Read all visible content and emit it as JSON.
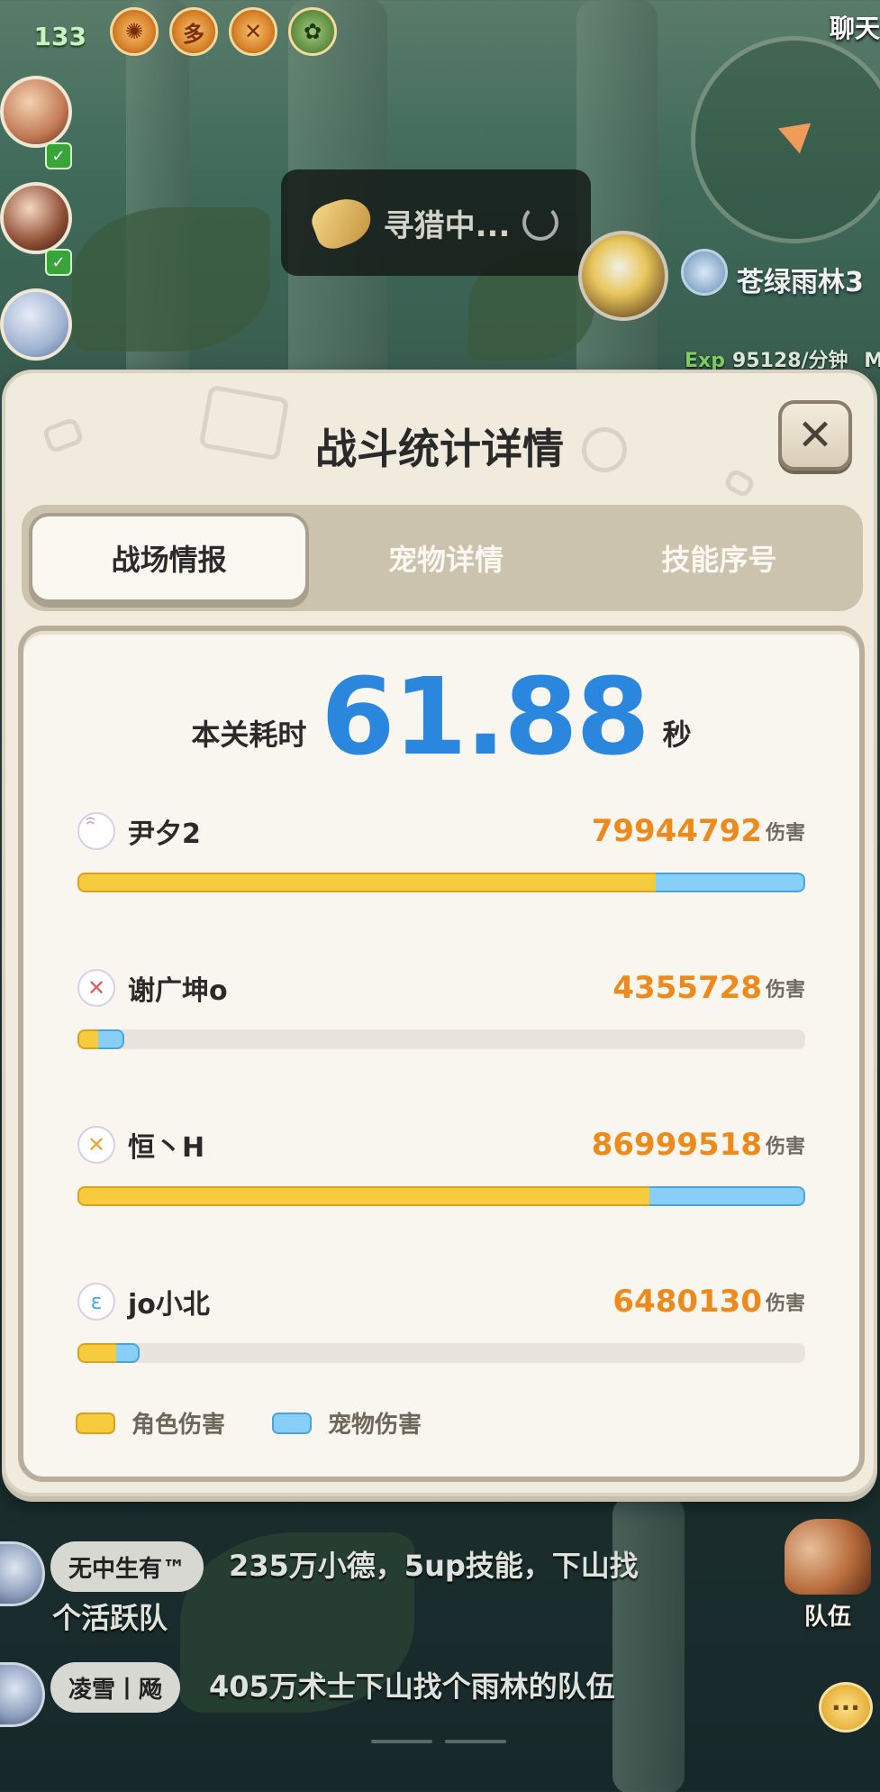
{
  "hud": {
    "level": "133",
    "chat_label": "聊天",
    "hunting_text": "寻猎中...",
    "zone_name": "苍绿雨林3",
    "exp_key": "Exp",
    "exp_value": "95128/分钟",
    "exp_suffix": "Ma"
  },
  "buffs": [
    "✺",
    "多",
    "✕",
    "✿"
  ],
  "modal": {
    "title": "战斗统计详情",
    "close_label": "✕",
    "tabs": [
      {
        "label": "战场情报",
        "active": true
      },
      {
        "label": "宠物详情",
        "active": false
      },
      {
        "label": "技能序号",
        "active": false
      }
    ],
    "time_label": "本关耗时",
    "time_value": "61.88",
    "time_unit": "秒",
    "damage_unit": "伤害",
    "players": [
      {
        "name": "尹夕2",
        "damage": "79944792",
        "icon": "swirl-class-icon",
        "glyph": "ꩰ",
        "icon_color": "#b48de0",
        "char_share": 0.795,
        "pet_share": 0.205,
        "bar_fill": 1.0
      },
      {
        "name": "谢广坤o",
        "damage": "4355728",
        "icon": "demon-class-icon",
        "glyph": "✕",
        "icon_color": "#e25b63",
        "char_share": 0.45,
        "pet_share": 0.55,
        "bar_fill": 0.064
      },
      {
        "name": "恒丶H",
        "damage": "86999518",
        "icon": "blade-class-icon",
        "glyph": "✕",
        "icon_color": "#f2a23a",
        "char_share": 0.786,
        "pet_share": 0.214,
        "bar_fill": 1.0
      },
      {
        "name": "jo小北",
        "damage": "6480130",
        "icon": "wave-class-icon",
        "glyph": "ɛ",
        "icon_color": "#4ea7e8",
        "char_share": 0.62,
        "pet_share": 0.38,
        "bar_fill": 0.085
      }
    ],
    "legend": {
      "char": "角色伤害",
      "pet": "宠物伤害"
    },
    "colors": {
      "char": "#f6cb3e",
      "pet": "#88cff7",
      "time": "#2b86dd",
      "damage": "#ee8a1c"
    }
  },
  "chat": {
    "messages": [
      {
        "tag": "无中生有™",
        "line1": "235万小德，5up技能，下山找",
        "line2": "个活跃队"
      },
      {
        "tag": "凌雪丨飏",
        "line1": "405万术士下山找个雨林的队伍",
        "line2": ""
      }
    ],
    "team_label": "队伍"
  }
}
